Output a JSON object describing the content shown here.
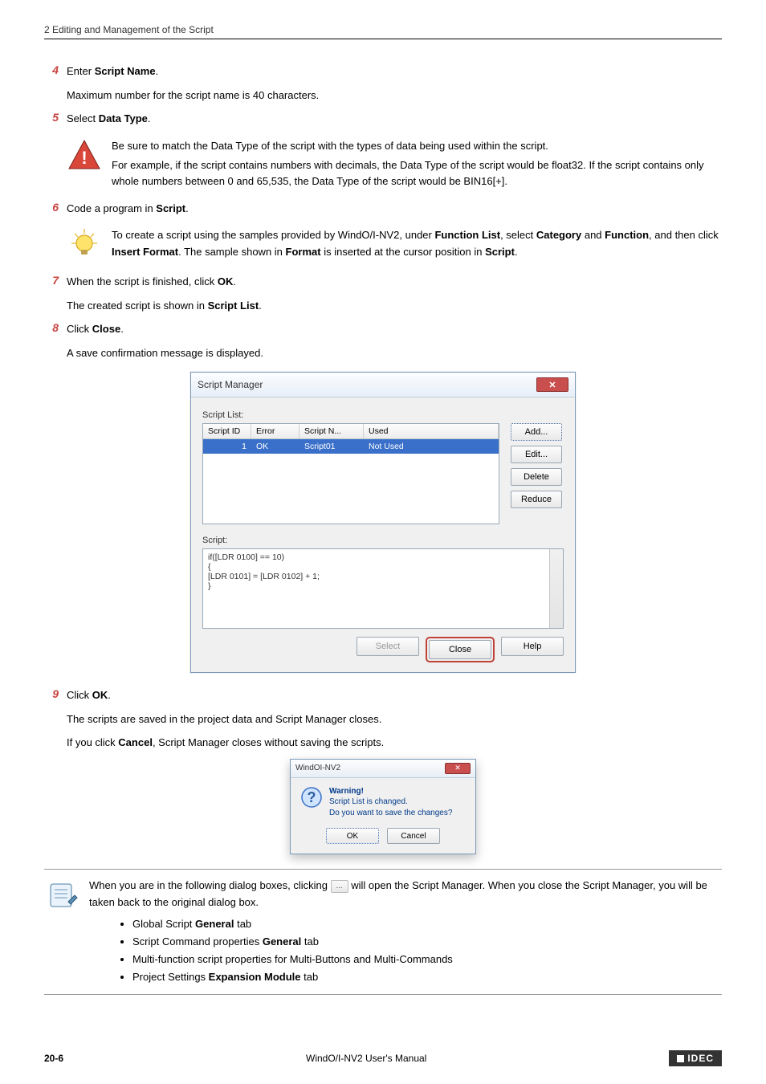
{
  "header": {
    "breadcrumb": "2 Editing and Management of the Script"
  },
  "steps": {
    "s4": {
      "num": "4",
      "line1_a": "Enter ",
      "line1_b": "Script Name",
      "line1_c": ".",
      "sub": "Maximum number for the script name is 40 characters."
    },
    "s5": {
      "num": "5",
      "line_a": "Select ",
      "line_b": "Data Type",
      "line_c": "."
    },
    "s6": {
      "num": "6",
      "line_a": "Code a program in ",
      "line_b": "Script",
      "line_c": "."
    },
    "s7": {
      "num": "7",
      "line_a": "When the script is finished, click ",
      "line_b": "OK",
      "line_c": ".",
      "sub_a": "The created script is shown in ",
      "sub_b": "Script List",
      "sub_c": "."
    },
    "s8": {
      "num": "8",
      "line_a": "Click ",
      "line_b": "Close",
      "line_c": ".",
      "sub": "A save confirmation message is displayed."
    },
    "s9": {
      "num": "9",
      "line_a": "Click ",
      "line_b": "OK",
      "line_c": ".",
      "sub1": "The scripts are saved in the project data and Script Manager closes.",
      "sub2_a": "If you click ",
      "sub2_b": "Cancel",
      "sub2_c": ", Script Manager closes without saving the scripts."
    }
  },
  "callout_warn": {
    "p1": "Be sure to match the Data Type of the script with the types of data being used within the script.",
    "p2": "For example, if the script contains numbers with decimals, the Data Type of the script would be float32. If the script contains only whole numbers between 0 and 65,535, the Data Type of the script would be BIN16[+]."
  },
  "callout_tip": {
    "t1": "To create a script using the samples provided by WindO/I-NV2, under ",
    "t2": "Function List",
    "t3": ", select ",
    "t4": "Category",
    "t5": " and ",
    "t6": "Function",
    "t7": ", and then click ",
    "t8": "Insert Format",
    "t9": ". The sample shown in ",
    "t10": "Format",
    "t11": " is inserted at the cursor position in ",
    "t12": "Script",
    "t13": "."
  },
  "callout_note": {
    "intro_a": "When you are in the following dialog boxes, clicking ",
    "intro_b": " will open the Script Manager. When you close the Script Manager, you will be taken back to the original dialog box.",
    "b1_a": "Global Script ",
    "b1_b": "General",
    "b1_c": " tab",
    "b2_a": "Script Command properties ",
    "b2_b": "General",
    "b2_c": " tab",
    "b3": "Multi-function script properties for Multi-Buttons and Multi-Commands",
    "b4_a": "Project Settings ",
    "b4_b": "Expansion Module",
    "b4_c": " tab"
  },
  "dialog": {
    "title": "Script Manager",
    "close_x": "✕",
    "list_label": "Script List:",
    "head": {
      "c1": "Script ID",
      "c2": "Error",
      "c3": "Script N...",
      "c4": "Used"
    },
    "row": {
      "c1": "1",
      "c2": "OK",
      "c3": "Script01",
      "c4": "Not Used"
    },
    "btns": {
      "add": "Add...",
      "edit": "Edit...",
      "delete": "Delete",
      "reduce": "Reduce"
    },
    "script_label": "Script:",
    "code": "if([LDR 0100] == 10)\n{\n[LDR 0101] = [LDR 0102] + 1;\n}",
    "foot": {
      "select": "Select",
      "close": "Close",
      "help": "Help"
    }
  },
  "small_dialog": {
    "title": "WindOI-NV2",
    "warn": "Warning!",
    "l1": "Script List is changed.",
    "l2": "Do you want to save the changes?",
    "ok": "OK",
    "cancel": "Cancel"
  },
  "footer": {
    "page": "20-6",
    "manual": "WindO/I-NV2 User's Manual",
    "brand": "IDEC"
  }
}
